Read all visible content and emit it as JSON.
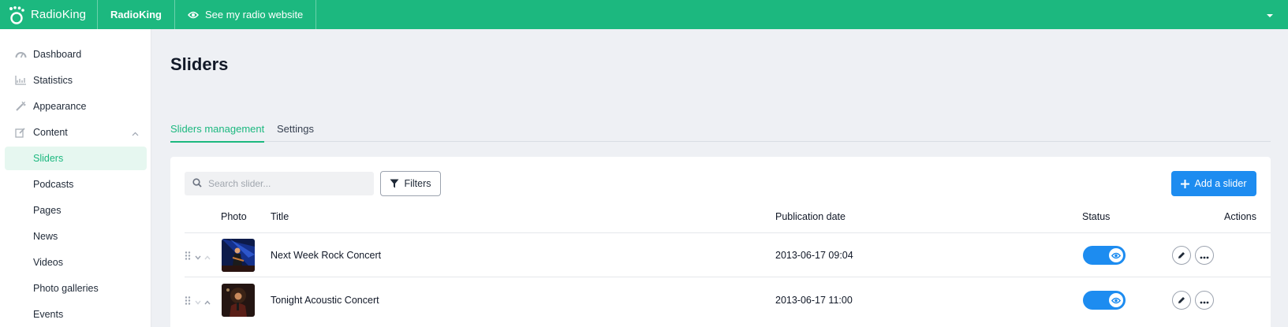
{
  "topbar": {
    "brand": "RadioKing",
    "station": "RadioKing",
    "see_site": "See my radio website",
    "icons": {
      "logo": "radioking-crown-logo",
      "eye": "eye-icon",
      "caret": "caret-down-icon"
    }
  },
  "sidebar": {
    "items": [
      {
        "label": "Dashboard",
        "icon": "gauge-icon"
      },
      {
        "label": "Statistics",
        "icon": "chart-icon"
      },
      {
        "label": "Appearance",
        "icon": "magic-wand-icon"
      },
      {
        "label": "Content",
        "icon": "edit-icon"
      },
      {
        "label": "Sliders"
      },
      {
        "label": "Podcasts"
      },
      {
        "label": "Pages"
      },
      {
        "label": "News"
      },
      {
        "label": "Videos"
      },
      {
        "label": "Photo galleries"
      },
      {
        "label": "Events"
      }
    ],
    "active": "Sliders"
  },
  "page": {
    "title": "Sliders",
    "tabs": [
      {
        "label": "Sliders management",
        "active": true
      },
      {
        "label": "Settings",
        "active": false
      }
    ]
  },
  "toolbar": {
    "search_placeholder": "Search slider...",
    "filters_label": "Filters",
    "add_label": "Add a slider"
  },
  "table": {
    "columns": [
      "Photo",
      "Title",
      "Publication date",
      "Status",
      "Actions"
    ],
    "rows": [
      {
        "title": "Next Week Rock Concert",
        "date": "2013-06-17 09:04",
        "visible": true
      },
      {
        "title": "Tonight Acoustic Concert",
        "date": "2013-06-17 11:00",
        "visible": true
      }
    ]
  },
  "colors": {
    "brand_green": "#1cb87f",
    "primary_blue": "#1d8cf0",
    "background": "#eef0f4"
  }
}
